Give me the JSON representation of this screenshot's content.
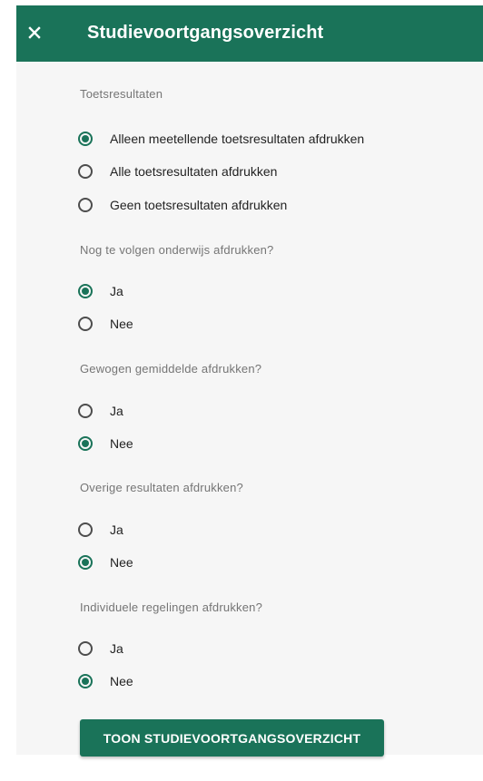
{
  "header": {
    "title": "Studievoortgangsoverzicht",
    "close_icon": "close-icon",
    "background": "#1a7359"
  },
  "sections": [
    {
      "label": "Toetsresultaten",
      "options": [
        {
          "label": "Alleen meetellende toetsresultaten afdrukken",
          "checked": true
        },
        {
          "label": "Alle toetsresultaten afdrukken",
          "checked": false
        },
        {
          "label": "Geen toetsresultaten afdrukken",
          "checked": false
        }
      ]
    },
    {
      "label": "Nog te volgen onderwijs afdrukken?",
      "options": [
        {
          "label": "Ja",
          "checked": true
        },
        {
          "label": "Nee",
          "checked": false
        }
      ]
    },
    {
      "label": "Gewogen gemiddelde afdrukken?",
      "options": [
        {
          "label": "Ja",
          "checked": false
        },
        {
          "label": "Nee",
          "checked": true
        }
      ]
    },
    {
      "label": "Overige resultaten afdrukken?",
      "options": [
        {
          "label": "Ja",
          "checked": false
        },
        {
          "label": "Nee",
          "checked": true
        }
      ]
    },
    {
      "label": "Individuele regelingen afdrukken?",
      "options": [
        {
          "label": "Ja",
          "checked": false
        },
        {
          "label": "Nee",
          "checked": true
        }
      ]
    }
  ],
  "submit_button": {
    "label": "TOON STUDIEVOORTGANGSOVERZICHT"
  },
  "colors": {
    "accent": "#1a7359",
    "panel_background": "#f6f6f6"
  }
}
